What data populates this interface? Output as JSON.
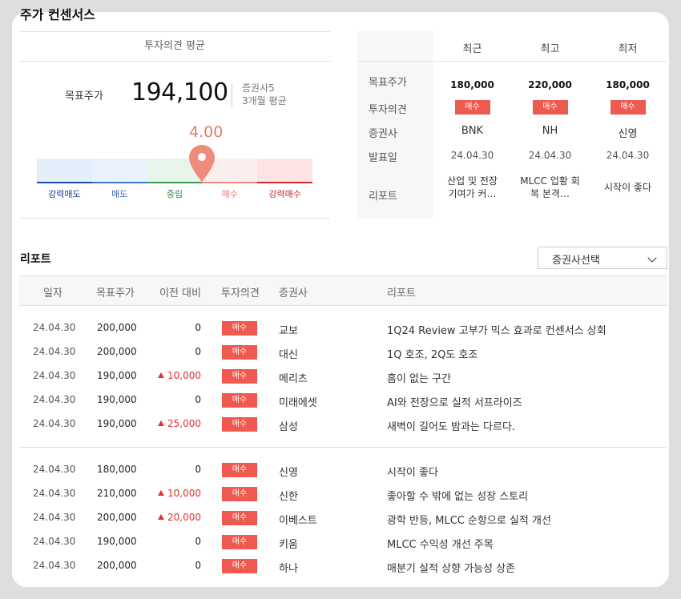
{
  "section_title": "주가 컨센서스",
  "opinion": {
    "header": "투자의견 평균",
    "target_label": "목표주가",
    "target_value": "194,100",
    "brokers": "증권사5",
    "period": "3개월 평균",
    "score": "4.00",
    "score_level": 0.6,
    "gauge_labels": [
      "강력매도",
      "매도",
      "중립",
      "매수",
      "강력매수"
    ]
  },
  "summary": {
    "columns": [
      "최근",
      "최고",
      "최저"
    ],
    "row_labels": [
      "목표주가",
      "투자의견",
      "증권사",
      "발표일",
      "리포트"
    ],
    "cells": [
      {
        "price": "180,000",
        "opinion": "매수",
        "broker": "BNK",
        "date": "24.04.30",
        "report_l1": "산업 및 전장",
        "report_l2": "기여가 커…"
      },
      {
        "price": "220,000",
        "opinion": "매수",
        "broker": "NH",
        "date": "24.04.30",
        "report_l1": "MLCC 업황 회",
        "report_l2": "복 본격…"
      },
      {
        "price": "180,000",
        "opinion": "매수",
        "broker": "신영",
        "date": "24.04.30",
        "report_l1": "시작이 좋다",
        "report_l2": ""
      }
    ]
  },
  "reports": {
    "title": "리포트",
    "select_label": "증권사선택",
    "headers": [
      "일자",
      "목표주가",
      "이전 대비",
      "투자의견",
      "증권사",
      "리포트"
    ],
    "rows": [
      {
        "date": "24.04.30",
        "price": "200,000",
        "diff": "0",
        "up": false,
        "opinion": "매수",
        "broker": "교보",
        "report": "1Q24 Review 고부가 믹스 효과로 컨센서스 상회"
      },
      {
        "date": "24.04.30",
        "price": "200,000",
        "diff": "0",
        "up": false,
        "opinion": "매수",
        "broker": "대신",
        "report": "1Q 호조, 2Q도 호조"
      },
      {
        "date": "24.04.30",
        "price": "190,000",
        "diff": "10,000",
        "up": true,
        "opinion": "매수",
        "broker": "메리츠",
        "report": "흠이 없는 구간"
      },
      {
        "date": "24.04.30",
        "price": "190,000",
        "diff": "0",
        "up": false,
        "opinion": "매수",
        "broker": "미래에셋",
        "report": "AI와 전장으로 실적 서프라이즈"
      },
      {
        "date": "24.04.30",
        "price": "190,000",
        "diff": "25,000",
        "up": true,
        "opinion": "매수",
        "broker": "삼성",
        "report": "새벽이 길어도 밤과는 다르다."
      },
      {
        "date": "24.04.30",
        "price": "180,000",
        "diff": "0",
        "up": false,
        "opinion": "매수",
        "broker": "신영",
        "report": "시작이 좋다"
      },
      {
        "date": "24.04.30",
        "price": "210,000",
        "diff": "10,000",
        "up": true,
        "opinion": "매수",
        "broker": "신한",
        "report": "좋아할 수 밖에 없는 성장 스토리"
      },
      {
        "date": "24.04.30",
        "price": "200,000",
        "diff": "20,000",
        "up": true,
        "opinion": "매수",
        "broker": "이베스트",
        "report": "광학 반등, MLCC 순항으로 실적 개선"
      },
      {
        "date": "24.04.30",
        "price": "190,000",
        "diff": "0",
        "up": false,
        "opinion": "매수",
        "broker": "키움",
        "report": "MLCC 수익성 개선 주목"
      },
      {
        "date": "24.04.30",
        "price": "200,000",
        "diff": "0",
        "up": false,
        "opinion": "매수",
        "broker": "하나",
        "report": "매분기 실적 상향 가능성 상존"
      }
    ]
  },
  "colors": {
    "accent": "#ee5a4f",
    "score": "#e8796b",
    "up": "#e03030"
  }
}
